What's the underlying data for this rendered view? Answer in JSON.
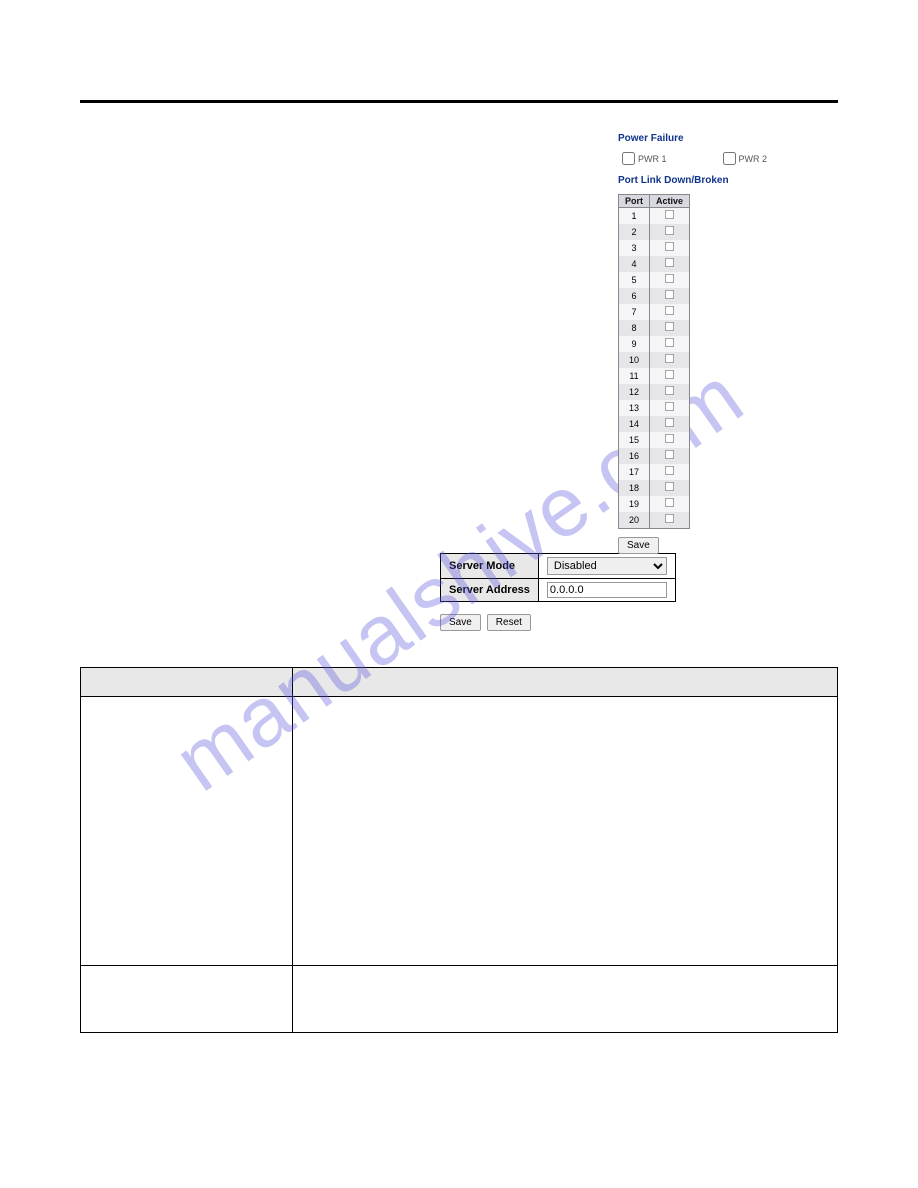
{
  "watermark": "manualshive.com",
  "powerFailure": {
    "heading": "Power Failure",
    "pwr1_label": "PWR 1",
    "pwr2_label": "PWR 2"
  },
  "portLink": {
    "heading": "Port Link Down/Broken",
    "cols": {
      "port": "Port",
      "active": "Active"
    },
    "ports": [
      "1",
      "2",
      "3",
      "4",
      "5",
      "6",
      "7",
      "8",
      "9",
      "10",
      "11",
      "12",
      "13",
      "14",
      "15",
      "16",
      "17",
      "18",
      "19",
      "20"
    ]
  },
  "buttons": {
    "save": "Save",
    "reset": "Reset"
  },
  "serverCfg": {
    "mode_label": "Server Mode",
    "mode_value": "Disabled",
    "address_label": "Server Address",
    "address_value": "0.0.0.0"
  },
  "descTable": {
    "col1_width": "28%"
  }
}
